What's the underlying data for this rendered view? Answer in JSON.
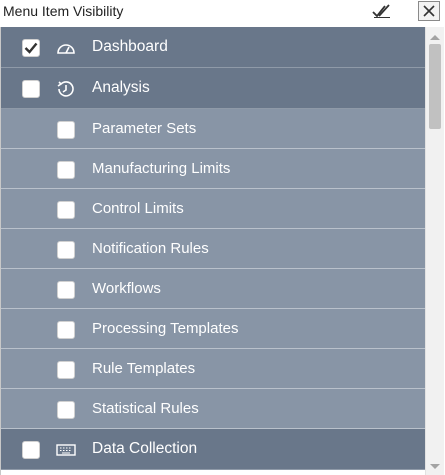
{
  "window": {
    "title": "Menu Item Visibility"
  },
  "toolbar": {
    "check_all_icon": "double-check-icon",
    "close_icon": "close-icon"
  },
  "items": [
    {
      "label": "Dashboard",
      "level": 0,
      "checked": true,
      "icon": "speedometer-icon"
    },
    {
      "label": "Analysis",
      "level": 0,
      "checked": false,
      "icon": "history-icon"
    },
    {
      "label": "Parameter Sets",
      "level": 1,
      "checked": false
    },
    {
      "label": "Manufacturing Limits",
      "level": 1,
      "checked": false
    },
    {
      "label": "Control Limits",
      "level": 1,
      "checked": false
    },
    {
      "label": "Notification Rules",
      "level": 1,
      "checked": false
    },
    {
      "label": "Workflows",
      "level": 1,
      "checked": false
    },
    {
      "label": "Processing Templates",
      "level": 1,
      "checked": false
    },
    {
      "label": "Rule Templates",
      "level": 1,
      "checked": false
    },
    {
      "label": "Statistical Rules",
      "level": 1,
      "checked": false
    },
    {
      "label": "Data Collection",
      "level": 0,
      "checked": false,
      "icon": "keyboard-icon"
    }
  ],
  "colors": {
    "top_row_bg": "#69778a",
    "sub_row_bg": "#8895a6",
    "row_text": "#ffffff"
  }
}
